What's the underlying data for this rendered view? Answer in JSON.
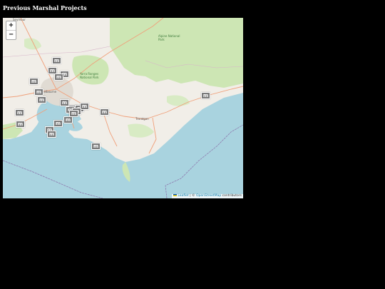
{
  "page": {
    "title": "Previous Marshal Projects"
  },
  "map": {
    "zoom_in_label": "+",
    "zoom_out_label": "−",
    "marker_glyph": "m",
    "marker_color": "#7a7a7a",
    "marker_count": 23,
    "labels": {
      "melbourne": "Melbourne",
      "traralgon": "Traralgon",
      "alpine": "Alpine National Park",
      "yarra": "Yarra Ranges National Park",
      "seymour": "Seymour"
    },
    "attribution": {
      "leaflet": "Leaflet",
      "separator": " | © ",
      "osm": "OpenStreetMap",
      "suffix": " contributors"
    },
    "colors": {
      "sea": "#a9d3df",
      "land": "#f1eee8",
      "forest": "#cde6b4",
      "roads": "#f0a07a"
    }
  }
}
